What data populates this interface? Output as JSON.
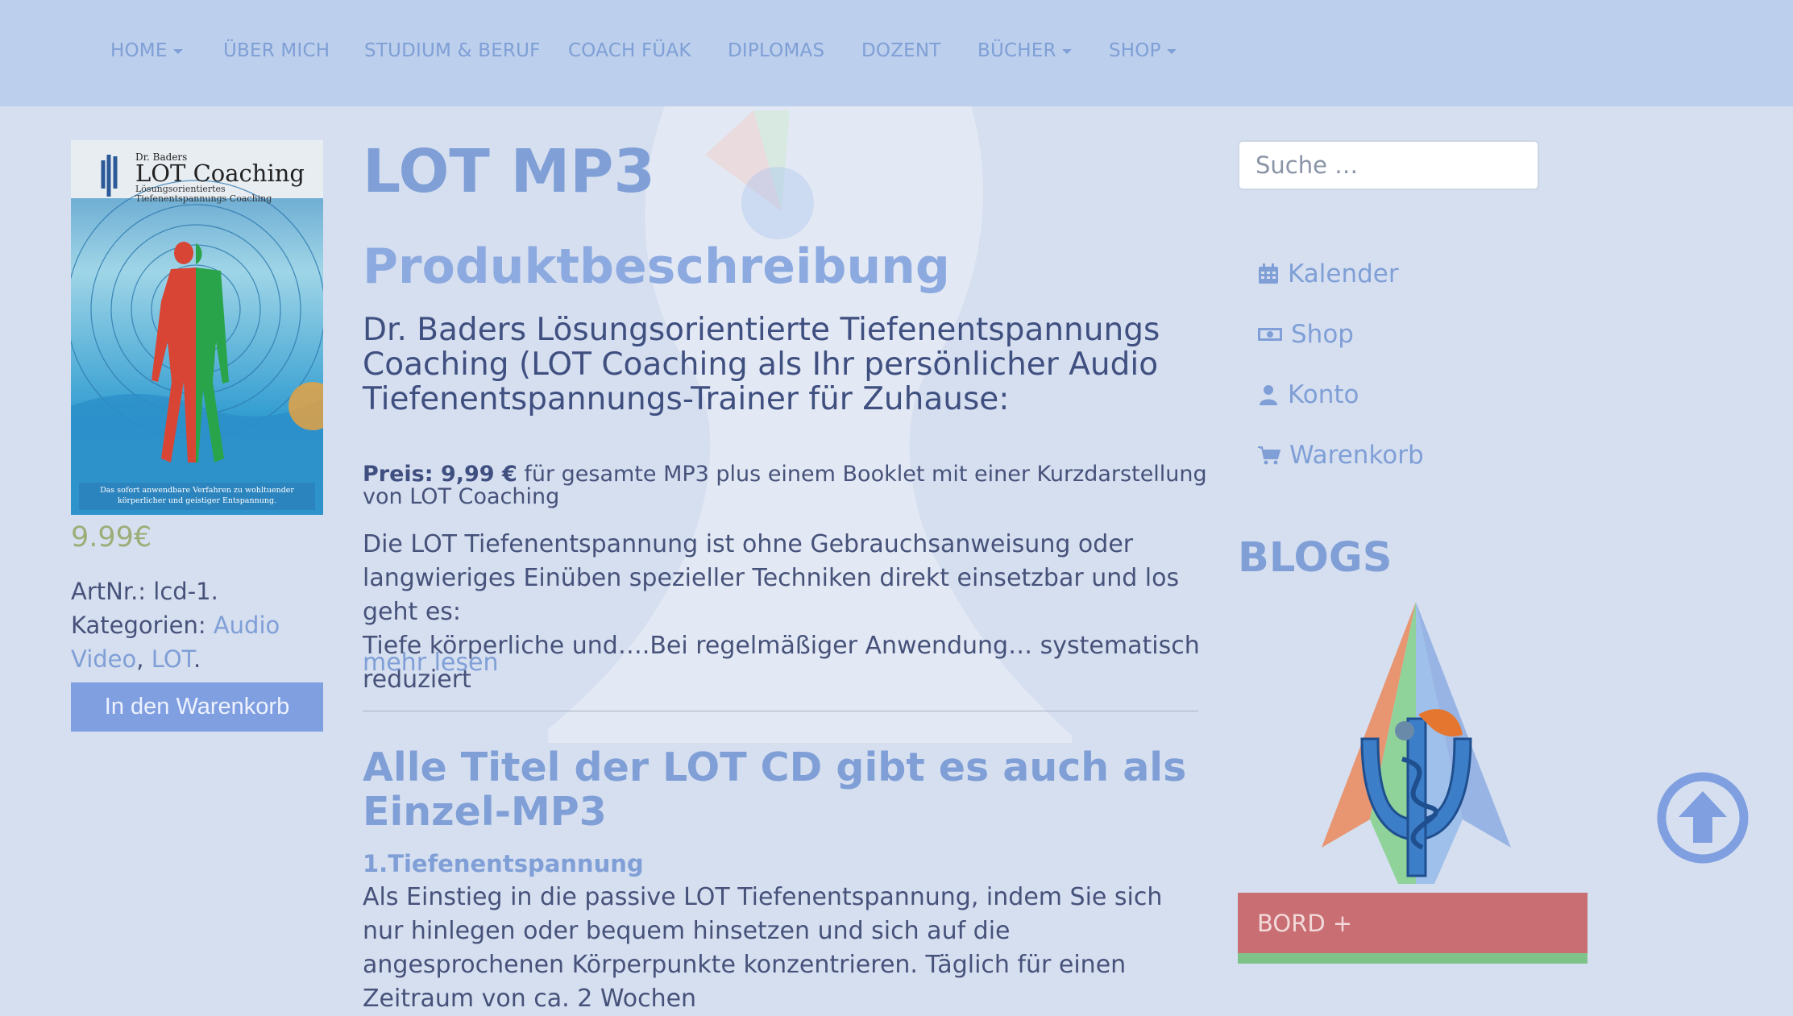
{
  "nav": {
    "items": [
      {
        "label": "HOME",
        "dropdown": true
      },
      {
        "label": "ÜBER MICH",
        "dropdown": false
      },
      {
        "label": "STUDIUM & BERUF",
        "dropdown": false
      },
      {
        "label": "COACH FÜAK",
        "dropdown": false
      },
      {
        "label": "DIPLOMAS",
        "dropdown": false
      },
      {
        "label": "DOZENT",
        "dropdown": false
      },
      {
        "label": "BÜCHER",
        "dropdown": true
      },
      {
        "label": "SHOP",
        "dropdown": true
      }
    ]
  },
  "product": {
    "cover": {
      "author": "Dr. Baders",
      "title": "LOT Coaching",
      "subtitle_line1": "Lösungsorientiertes",
      "subtitle_line2": "Tiefenentspannungs Coaching",
      "caption_line1": "Das sofort anwendbare Verfahren zu wohltuender",
      "caption_line2": "körperlicher und geistiger Entspannung."
    },
    "price": "9.99€",
    "artnr_label": "ArtNr.:",
    "artnr_value": "lcd-1.",
    "categories_label": "Kategorien:",
    "category_1": "Audio Video",
    "category_sep": ",",
    "category_2": "LOT",
    "category_end": ".",
    "cart_button": "In den Warenkorb"
  },
  "main": {
    "title": "LOT MP3",
    "subtitle": "Produktbeschreibung",
    "lead": "Dr. Baders Lösungsorientierte Tiefenentspannungs Coaching (LOT Coaching als Ihr persönlicher Audio Tiefenentspannungs-Trainer für Zuhause:",
    "price_strong": "Preis: 9,99 €",
    "price_rest": " für gesamte MP3 plus einem Booklet mit einer Kurzdarstellung von LOT Coaching",
    "body_line1": "Die LOT Tiefenentspannung ist ohne Gebrauchsanweisung oder langwieriges Einüben spezieller Techniken direkt einsetzbar und los geht es:",
    "body_line2": "Tiefe körperliche und….Bei regelmäßiger Anwendung… systematisch reduziert",
    "more_link": "mehr lesen",
    "section_title": "Alle Titel der LOT CD gibt es auch als Einzel-MP3",
    "item_title": "1.Tiefenentspannung",
    "item_text": "Als Einstieg in die passive LOT Tiefenentspannung, indem Sie sich nur hinlegen oder bequem hinsetzen und sich auf die angesprochenen Körperpunkte konzentrieren. Täglich für einen Zeitraum von ca. 2 Wochen"
  },
  "sidebar": {
    "search_placeholder": "Suche …",
    "links": [
      {
        "label": "Kalender",
        "icon": "calendar-icon"
      },
      {
        "label": "Shop",
        "icon": "money-icon"
      },
      {
        "label": "Konto",
        "icon": "user-icon"
      },
      {
        "label": "Warenkorb",
        "icon": "cart-icon"
      }
    ],
    "blogs_heading": "BLOGS",
    "bord_label": "BORD +"
  },
  "colors": {
    "nav_bg": "#bccfec",
    "page_bg": "#d6dff0",
    "accent": "#7f9fd6",
    "button_bg": "#7f9fe0",
    "bord_bg": "#c96e72",
    "green": "#7ec38a"
  }
}
